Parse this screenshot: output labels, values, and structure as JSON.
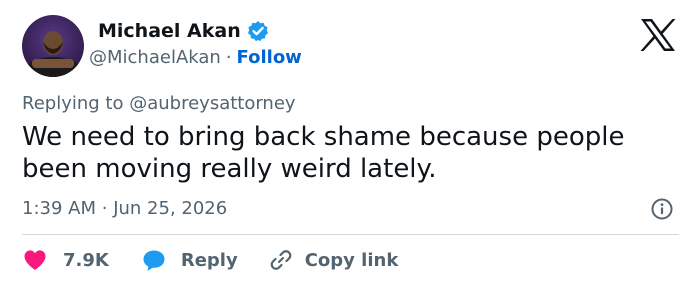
{
  "author": {
    "name": "Michael Akan",
    "handle": "@MichaelAkan",
    "separator": "·",
    "follow_label": "Follow",
    "verified_icon": "verified-badge-icon"
  },
  "platform_logo": "x-logo-icon",
  "tweet": {
    "reply_prefix": "Replying to",
    "reply_handle": "@aubreysattorney",
    "text": "We need to bring back shame because people been moving really weird lately.",
    "time": "1:39 AM",
    "separator": "·",
    "date": "Jun 25, 2026"
  },
  "actions": {
    "likes": "7.9K",
    "reply_label": "Reply",
    "copy_link_label": "Copy link"
  },
  "colors": {
    "accent": "#0064d2",
    "heart": "#f91880",
    "reply_bubble": "#1d9bf0",
    "verified": "#1d9bf0",
    "muted_text": "#536471"
  }
}
